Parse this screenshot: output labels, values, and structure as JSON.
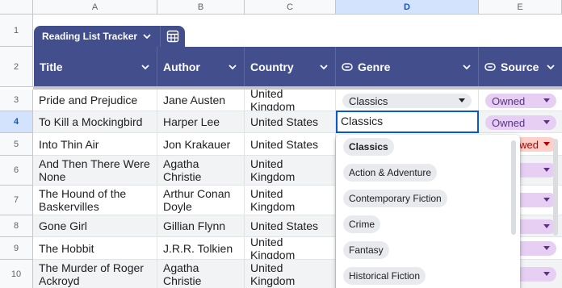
{
  "columns": [
    "A",
    "B",
    "C",
    "D",
    "E"
  ],
  "rows": [
    "1",
    "2",
    "3",
    "4",
    "5",
    "6",
    "7",
    "8",
    "9",
    "10"
  ],
  "table": {
    "tab_name": "Reading List Tracker",
    "headers": {
      "title": "Title",
      "author": "Author",
      "country": "Country",
      "genre": "Genre",
      "source": "Source"
    },
    "data": [
      {
        "title": "Pride and Prejudice",
        "author": "Jane Austen",
        "country": "United Kingdom",
        "genre": "Classics",
        "source": "Owned"
      },
      {
        "title": "To Kill a Mockingbird",
        "author": "Harper Lee",
        "country": "United States",
        "genre": "Classics",
        "source": "Owned"
      },
      {
        "title": "Into Thin Air",
        "author": "Jon Krakauer",
        "country": "United States",
        "genre": "",
        "source": "wed"
      },
      {
        "title": "And Then There Were None",
        "author": "Agatha Christie",
        "country": "United Kingdom",
        "genre": "",
        "source": ""
      },
      {
        "title": "The Hound of the Baskervilles",
        "author": "Arthur Conan Doyle",
        "country": "United Kingdom",
        "genre": "",
        "source": ""
      },
      {
        "title": "Gone Girl",
        "author": "Gillian Flynn",
        "country": "United States",
        "genre": "",
        "source": ""
      },
      {
        "title": "The Hobbit",
        "author": "J.R.R. Tolkien",
        "country": "United Kingdom",
        "genre": "",
        "source": ""
      },
      {
        "title": "The Murder of Roger Ackroyd",
        "author": "Agatha Christie",
        "country": "United Kingdom",
        "genre": "",
        "source": ""
      }
    ]
  },
  "editor": {
    "value": "Classics"
  },
  "dropdown": {
    "options": [
      "Classics",
      "Action & Adventure",
      "Contemporary Fiction",
      "Crime",
      "Fantasy",
      "Historical Fiction"
    ],
    "selected": "Classics"
  },
  "colors": {
    "header_bg": "#434f8c",
    "chip_owned": "#e6cff2",
    "chip_wanted": "#ffcfc9",
    "chip_genre": "#e8eaed",
    "selection": "#0b57d0"
  }
}
